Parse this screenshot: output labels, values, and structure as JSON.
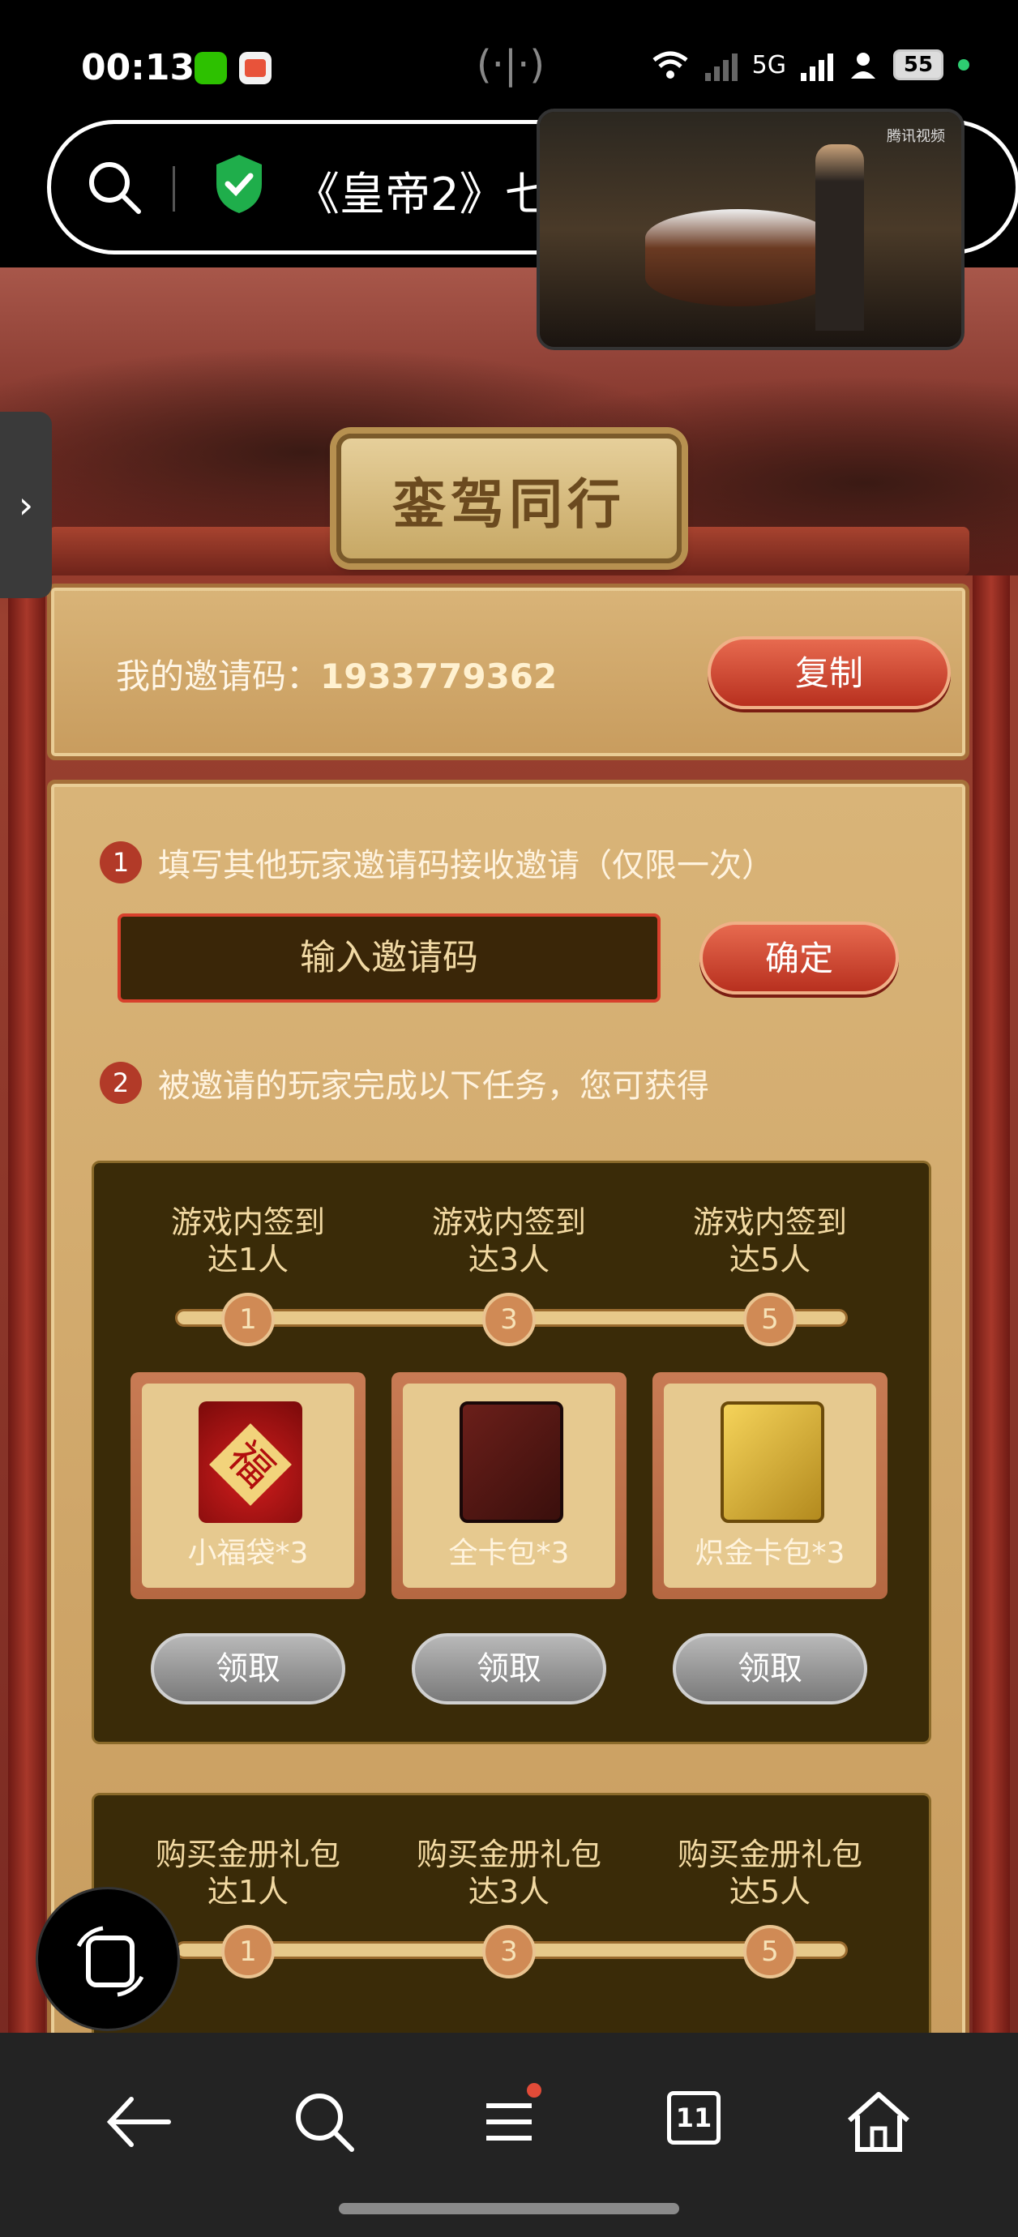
{
  "status_bar": {
    "time": "00:13",
    "battery": "55",
    "network": "5G"
  },
  "browser": {
    "url_text": "《皇帝2》七"
  },
  "page": {
    "title": "銮驾同行",
    "invite_code_label": "我的邀请码：",
    "invite_code": "1933779362",
    "copy_label": "复制",
    "step1_num": "1",
    "step1_text": "填写其他玩家邀请码接收邀请（仅限一次）",
    "code_input_placeholder": "输入邀请码",
    "confirm_label": "确定",
    "step2_num": "2",
    "step2_text": "被邀请的玩家完成以下任务，您可获得",
    "task_group_1": {
      "milestones": [
        {
          "line1": "游戏内签到",
          "line2": "达1人",
          "node": "1"
        },
        {
          "line1": "游戏内签到",
          "line2": "达3人",
          "node": "3"
        },
        {
          "line1": "游戏内签到",
          "line2": "达5人",
          "node": "5"
        }
      ],
      "rewards": [
        {
          "name": "小福袋*3",
          "claim": "领取"
        },
        {
          "name": "全卡包*3",
          "claim": "领取"
        },
        {
          "name": "炽金卡包*3",
          "claim": "领取"
        }
      ]
    },
    "task_group_2": {
      "milestones": [
        {
          "line1": "购买金册礼包",
          "line2": "达1人",
          "node": "1"
        },
        {
          "line1": "购买金册礼包",
          "line2": "达3人",
          "node": "3"
        },
        {
          "line1": "购买金册礼包",
          "line2": "达5人",
          "node": "5"
        }
      ]
    }
  },
  "pip_video": {
    "logo": "腾讯视频"
  },
  "bottom_nav": {
    "tabs_count": "11"
  },
  "colors": {
    "accent_red": "#b8301f",
    "panel_gold": "#d9b478",
    "dark_box": "#3a2b08"
  }
}
